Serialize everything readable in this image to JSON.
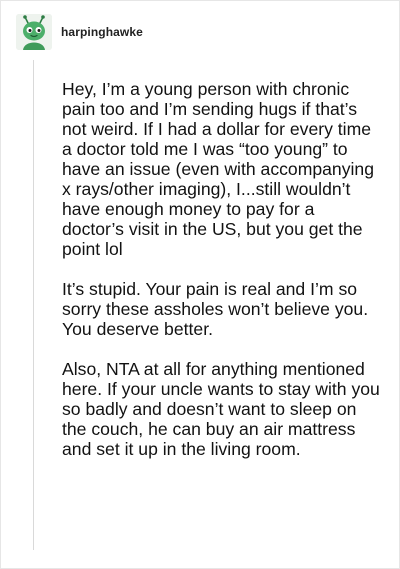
{
  "post": {
    "author": {
      "username": "harpinghawke",
      "avatar_icon": "green-creature-avatar"
    },
    "paragraphs": [
      "Hey, I’m a young person with chronic pain too and I’m sending hugs if that’s not weird. If I had a dollar for every time a doctor told me I was “too young” to have an issue (even with accompanying x rays/other imaging), I...still wouldn’t have enough money to pay for a doctor’s visit in the US, but you get the point lol",
      "It’s stupid. Your pain is real and I’m so sorry these assholes won’t believe you. You deserve better.",
      "Also, NTA at all for anything mentioned here. If your uncle wants to stay with you so badly and doesn’t want to sleep on the couch, he can buy an air mattress and set it up in the living room."
    ]
  },
  "colors": {
    "background": "#ffffff",
    "text": "#121212",
    "username": "#222222",
    "thread_line": "#d9d9d9",
    "avatar_green": "#4caf6a"
  }
}
